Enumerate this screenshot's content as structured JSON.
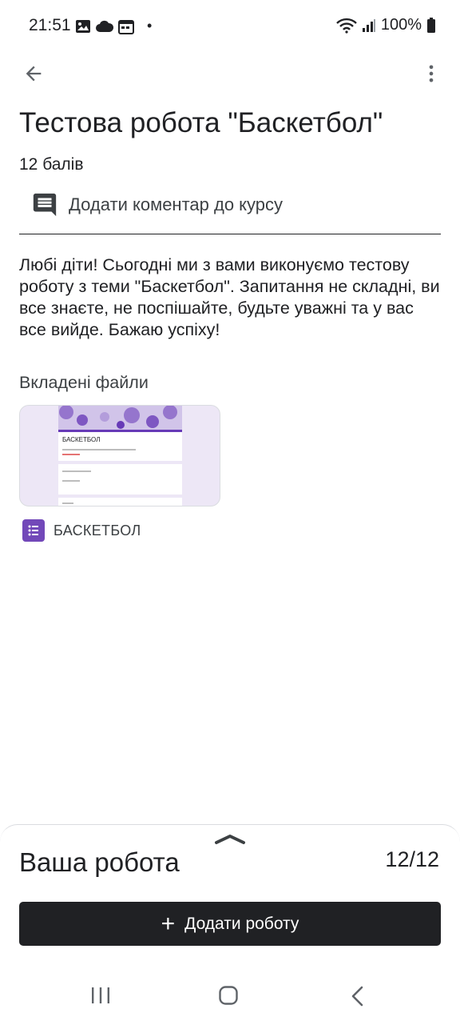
{
  "status_bar": {
    "time": "21:51",
    "battery": "100%",
    "dot": "•",
    "icons": [
      "image-icon",
      "cloud-icon",
      "calendar-icon",
      "wifi-icon",
      "signal-icon",
      "battery-icon"
    ]
  },
  "app_bar": {
    "back_icon": "arrow-back-icon",
    "more_icon": "more-vert-icon"
  },
  "assignment": {
    "title": "Тестова робота \"Баскетбол\"",
    "points": "12 балів",
    "comment_label": "Додати коментар до курсу",
    "description": "Любі діти! Сьогодні ми з вами виконуємо тестову роботу з теми \"Баскетбол\". Запитання не складні, ви все знаєте, не поспішайте, будьте уважні та у вас все вийде. Бажаю успіху!"
  },
  "attachments": {
    "heading": "Вкладені файли",
    "items": [
      {
        "name": "БАСКЕТБОЛ",
        "type_icon": "google-forms-icon",
        "preview_title": "БАСКЕТБОЛ",
        "accent_color": "#673ab7"
      }
    ]
  },
  "your_work": {
    "title": "Ваша робота",
    "count": "12/12",
    "add_button_label": "Додати роботу",
    "add_button_icon": "plus-icon"
  },
  "nav_bar": {
    "icons": [
      "recent-apps-icon",
      "home-icon",
      "back-icon"
    ]
  },
  "colors": {
    "text": "#202124",
    "button_bg": "#202124",
    "forms_purple": "#7248b9",
    "card_bg": "#ede7f6"
  }
}
